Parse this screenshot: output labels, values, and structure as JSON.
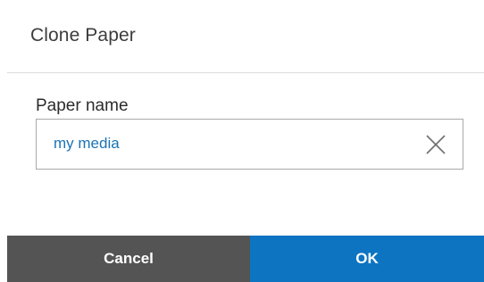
{
  "dialog": {
    "title": "Clone Paper"
  },
  "form": {
    "field_label": "Paper name",
    "field_value": "my media",
    "clear_icon": "close-x-icon"
  },
  "footer": {
    "cancel_label": "Cancel",
    "ok_label": "OK"
  },
  "colors": {
    "ok_button": "#0d74c2",
    "cancel_button": "#545454",
    "input_text": "#1a73b5"
  }
}
